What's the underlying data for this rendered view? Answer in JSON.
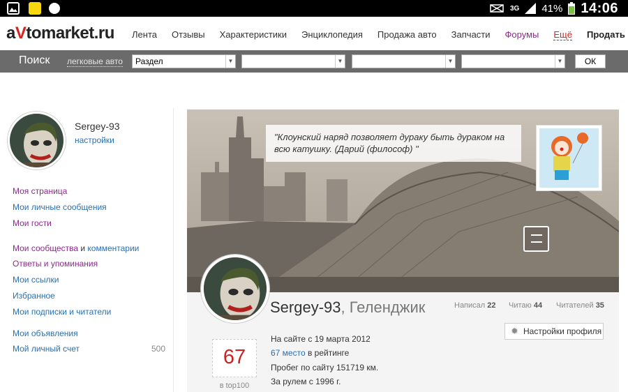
{
  "status_bar": {
    "battery": "41%",
    "network": "3G",
    "time": "14:06"
  },
  "header": {
    "logo": {
      "prefix": "a",
      "highlight": "V",
      "suffix": "tomarket.ru"
    },
    "nav": [
      {
        "label": "Лента"
      },
      {
        "label": "Отзывы"
      },
      {
        "label": "Характеристики"
      },
      {
        "label": "Энциклопедия"
      },
      {
        "label": "Продажа авто"
      },
      {
        "label": "Запчасти"
      },
      {
        "label": "Форумы"
      },
      {
        "label": "Ещё"
      },
      {
        "label": "Продать"
      }
    ]
  },
  "search": {
    "label": "Поиск",
    "category": "легковые авто",
    "select1": "Раздел",
    "select2": "",
    "select3": "",
    "select4": "",
    "ok": "ОК"
  },
  "sidebar": {
    "username": "Sergey-93",
    "settings": "настройки",
    "group1": [
      {
        "label": "Моя страница"
      },
      {
        "label": "Мои личные сообщения"
      },
      {
        "label": "Мои гости"
      }
    ],
    "communities": {
      "part1": "Мои сообщества",
      "and": " и ",
      "part2": "комментарии"
    },
    "group2": [
      {
        "label": "Ответы и упоминания"
      },
      {
        "label": "Мои ссылки"
      },
      {
        "label": "Избранное"
      },
      {
        "label": "Мои подписки и читатели"
      }
    ],
    "group3": [
      {
        "label": "Мои объявления"
      },
      {
        "label": "Мой личный счет",
        "value": "500"
      }
    ]
  },
  "profile": {
    "quote": "\"Клоунский наряд позволяет дураку быть дураком на всю катушку. (Дарий (философ) \"",
    "name": "Sergey-93",
    "city": ", Геленджик",
    "stats": [
      {
        "label": "Написал",
        "value": "22"
      },
      {
        "label": "Читаю",
        "value": "44"
      },
      {
        "label": "Читателей",
        "value": "35"
      }
    ],
    "settings_button": "Настройки профиля",
    "rank": "67",
    "rank_label": "в top100",
    "since": "На сайте с 19 марта 2012",
    "rating_link": "67 место",
    "rating_text": " в рейтинге",
    "mileage": "Пробег по сайту 151719 км.",
    "driving": "За рулем с 1996 г."
  },
  "colors": {
    "accent_red": "#d9211d",
    "link_blue": "#2a6fb0",
    "visited_purple": "#8a2a8a",
    "searchbar": "#6b6b6b"
  }
}
